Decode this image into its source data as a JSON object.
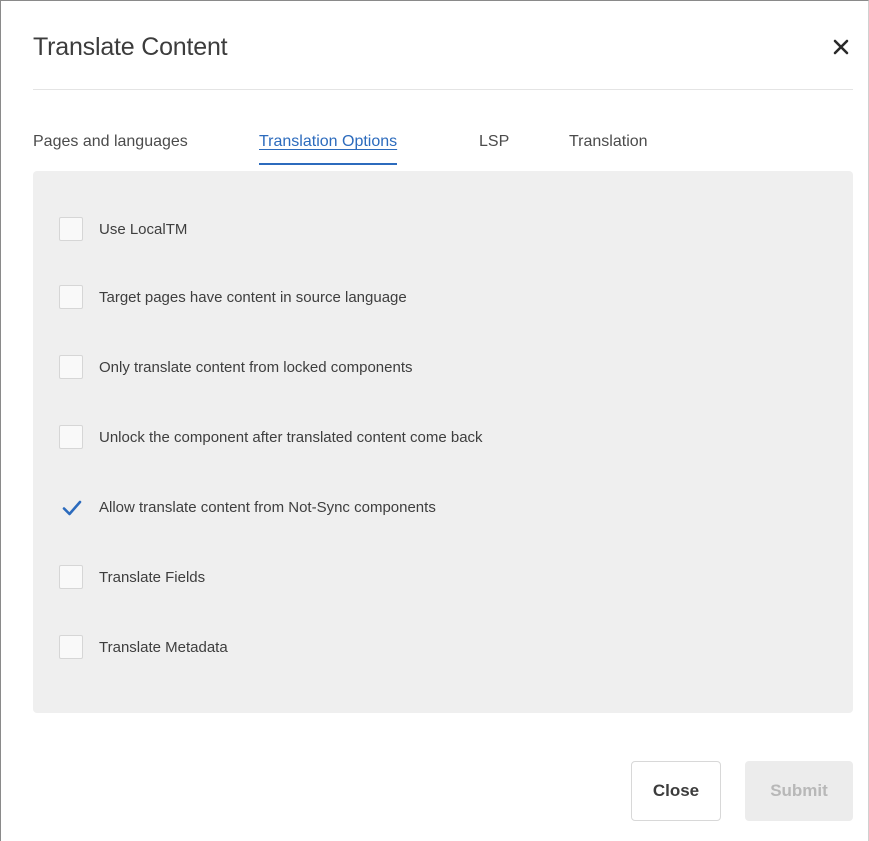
{
  "dialog": {
    "title": "Translate Content",
    "close_icon": "close-icon"
  },
  "tabs": [
    {
      "label": "Pages and languages",
      "active": false
    },
    {
      "label": "Translation Options",
      "active": true
    },
    {
      "label": "LSP",
      "active": false
    },
    {
      "label": "Translation",
      "active": false
    }
  ],
  "options": [
    {
      "label": "Use LocalTM",
      "checked": false
    },
    {
      "label": "Target pages have content in source language",
      "checked": false
    },
    {
      "label": "Only translate content from locked components",
      "checked": false
    },
    {
      "label": "Unlock the component after translated content come back",
      "checked": false
    },
    {
      "label": "Allow translate content from Not-Sync components",
      "checked": true
    },
    {
      "label": "Translate Fields",
      "checked": false
    },
    {
      "label": "Translate Metadata",
      "checked": false
    }
  ],
  "footer": {
    "close_label": "Close",
    "submit_label": "Submit",
    "submit_disabled": true
  },
  "colors": {
    "accent": "#2c6bbd",
    "panel_bg": "#efefef",
    "check_color": "#2c6bbd"
  }
}
